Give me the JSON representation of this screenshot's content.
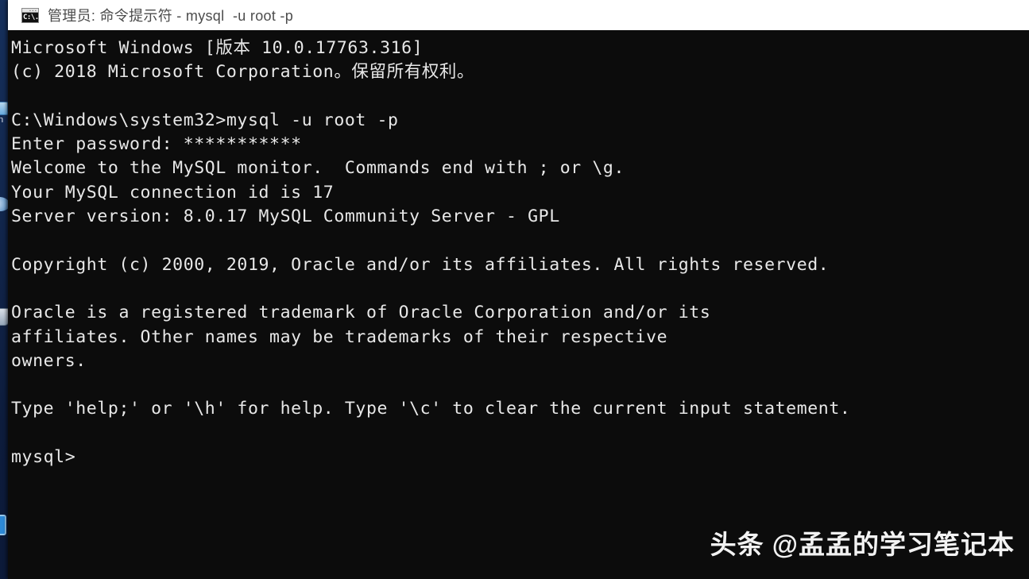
{
  "window": {
    "title": "管理员: 命令提示符 - mysql  -u root -p",
    "icon_name": "console-icon",
    "icon_text": "C:\\.",
    "title_bar_color": "#ffffff",
    "title_text_color": "#4c4c4c",
    "console_background": "#0c0c0c",
    "console_text_color": "#e8e8e8"
  },
  "desktop": {
    "background_color": "#12294f",
    "icons": [
      {
        "name": "computer-icon",
        "glyph": "glyph-monitor",
        "label": "n"
      },
      {
        "name": "network-icon",
        "glyph": "glyph-cloud",
        "label": ""
      },
      {
        "name": "recycle-bin-icon",
        "glyph": "glyph-bin",
        "label": ""
      },
      {
        "name": "app-shortcut-icon",
        "glyph": "glyph-blue",
        "label": ""
      }
    ]
  },
  "terminal": {
    "lines": [
      "Microsoft Windows [版本 10.0.17763.316]",
      "(c) 2018 Microsoft Corporation。保留所有权利。",
      "",
      "C:\\Windows\\system32>mysql -u root -p",
      "Enter password: ***********",
      "Welcome to the MySQL monitor.  Commands end with ; or \\g.",
      "Your MySQL connection id is 17",
      "Server version: 8.0.17 MySQL Community Server - GPL",
      "",
      "Copyright (c) 2000, 2019, Oracle and/or its affiliates. All rights reserved.",
      "",
      "Oracle is a registered trademark of Oracle Corporation and/or its",
      "affiliates. Other names may be trademarks of their respective",
      "owners.",
      "",
      "Type 'help;' or '\\h' for help. Type '\\c' to clear the current input statement.",
      "",
      "mysql>"
    ],
    "prompt": "mysql>"
  },
  "watermark": {
    "text": "头条 @孟孟的学习笔记本"
  }
}
